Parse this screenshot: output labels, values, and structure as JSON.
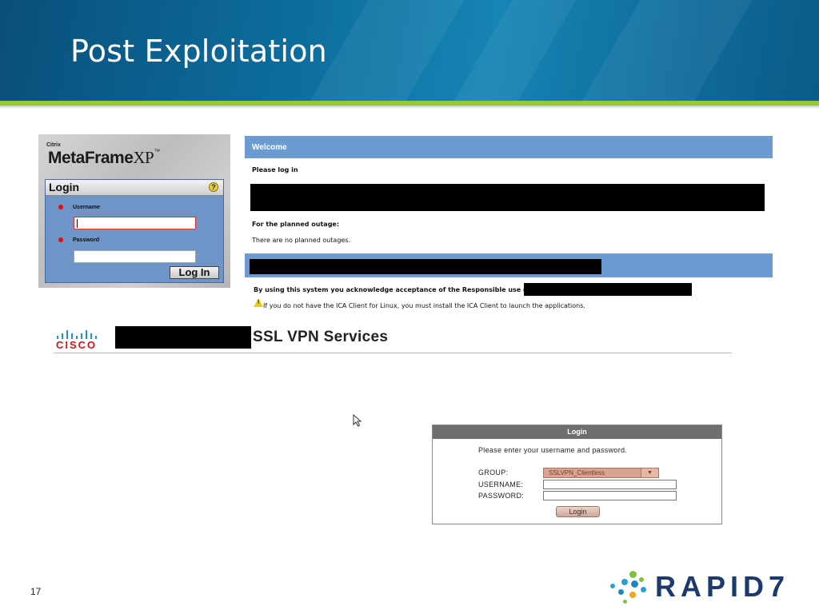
{
  "slide": {
    "title": "Post Exploitation",
    "page_number": "17"
  },
  "citrix": {
    "brand_small": "Citrix",
    "brand_main": "MetaFrame",
    "brand_xp": "XP",
    "brand_tm": "™",
    "login_heading": "Login",
    "help_glyph": "?",
    "username_label": "Username",
    "password_label": "Password",
    "login_button": "Log In"
  },
  "welcome": {
    "header": "Welcome",
    "please_log_in": "Please log in",
    "outage_heading": "For the planned outage:",
    "outage_text": "There are no planned outages.",
    "acceptance_text": "By using this system you acknowledge acceptance of the Responsible use of",
    "ica_notice": "If you do not have the ICA Client for Linux, you must install the ICA Client to launch the applications."
  },
  "cisco": {
    "logo_text": "CISCO",
    "service_title": "SSL VPN Services",
    "login_header": "Login",
    "prompt": "Please enter your username and password.",
    "group_label": "GROUP:",
    "group_value": "SSLVPN_Clientless",
    "username_label": "USERNAME:",
    "password_label": "PASSWORD:",
    "login_button": "Login"
  },
  "logo": {
    "brand": "RAPID7"
  },
  "colors": {
    "header_blue": "#0c6c9c",
    "accent_green": "#9cc33a",
    "welcome_bar": "#6b9bd1",
    "cisco_red": "#c8161d",
    "cisco_blue": "#1b94c8",
    "rapid_navy": "#1d3a6e"
  }
}
